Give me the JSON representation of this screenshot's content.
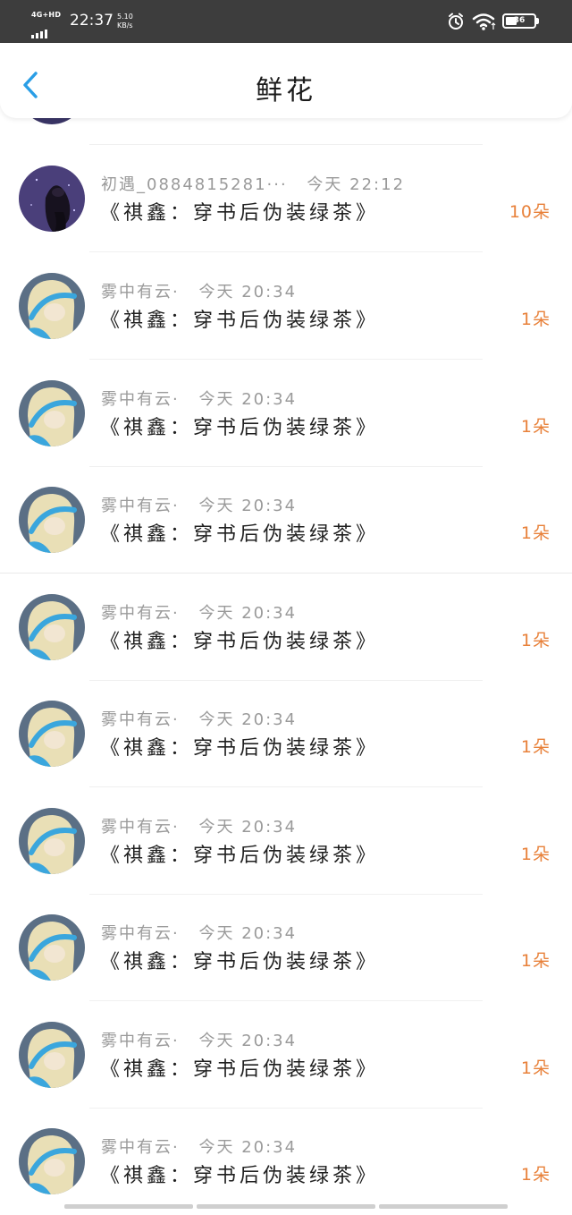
{
  "status_bar": {
    "network": "4G+HD",
    "time": "22:37",
    "speed_value": "5.10",
    "speed_unit": "KB/s",
    "battery": "36",
    "icons": [
      "signal-icon",
      "alarm-icon",
      "wifi-icon",
      "battery-icon"
    ]
  },
  "header": {
    "title": "鲜花",
    "back_icon": "chevron-left-icon",
    "accent_color": "#2a9ee6"
  },
  "list": {
    "count_color": "#e8813a",
    "items": [
      {
        "name": "初遇_0884815281···",
        "time": "今天 22:12",
        "book": "《祺鑫：穿书后伪装绿茶》",
        "count": "10朵"
      },
      {
        "name": "雾中有云·",
        "time": "今天 20:34",
        "book": "《祺鑫：穿书后伪装绿茶》",
        "count": "1朵"
      },
      {
        "name": "雾中有云·",
        "time": "今天 20:34",
        "book": "《祺鑫：穿书后伪装绿茶》",
        "count": "1朵"
      },
      {
        "name": "雾中有云·",
        "time": "今天 20:34",
        "book": "《祺鑫：穿书后伪装绿茶》",
        "count": "1朵"
      },
      {
        "name": "雾中有云·",
        "time": "今天 20:34",
        "book": "《祺鑫：穿书后伪装绿茶》",
        "count": "1朵"
      },
      {
        "name": "雾中有云·",
        "time": "今天 20:34",
        "book": "《祺鑫：穿书后伪装绿茶》",
        "count": "1朵"
      },
      {
        "name": "雾中有云·",
        "time": "今天 20:34",
        "book": "《祺鑫：穿书后伪装绿茶》",
        "count": "1朵"
      },
      {
        "name": "雾中有云·",
        "time": "今天 20:34",
        "book": "《祺鑫：穿书后伪装绿茶》",
        "count": "1朵"
      },
      {
        "name": "雾中有云·",
        "time": "今天 20:34",
        "book": "《祺鑫：穿书后伪装绿茶》",
        "count": "1朵"
      },
      {
        "name": "雾中有云·",
        "time": "今天 20:34",
        "book": "《祺鑫：穿书后伪装绿茶》",
        "count": "1朵"
      }
    ]
  }
}
